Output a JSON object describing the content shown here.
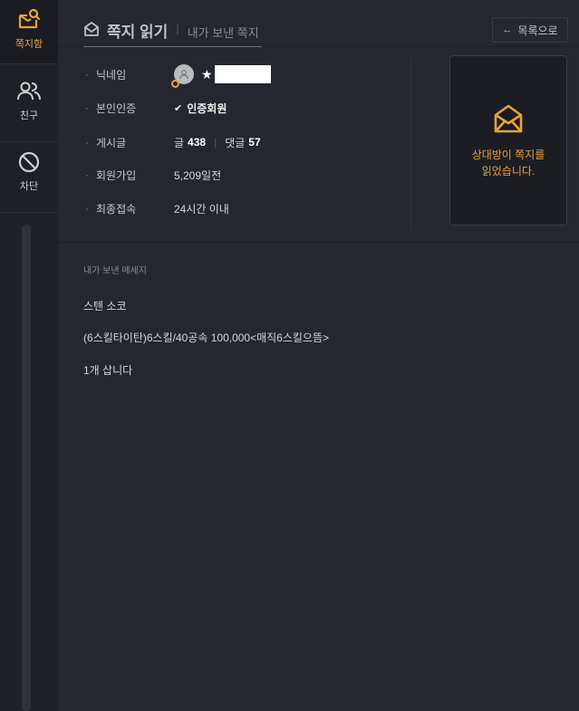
{
  "sidebar": {
    "items": [
      {
        "label": "쪽지함",
        "icon": "mail-search-icon",
        "active": true
      },
      {
        "label": "친구",
        "icon": "users-icon",
        "active": false
      },
      {
        "label": "차단",
        "icon": "block-icon",
        "active": false
      }
    ]
  },
  "header": {
    "title": "쪽지 읽기",
    "separator": "|",
    "subtitle": "내가 보낸 쪽지",
    "back_label": "목록으로",
    "back_arrow": "←"
  },
  "profile": {
    "bullet": "·",
    "nickname": {
      "label": "닉네임",
      "star": "★"
    },
    "verification": {
      "label": "본인인증",
      "check": "✔",
      "value": "인증회원"
    },
    "posts": {
      "label": "게시글",
      "post_label": "글",
      "post_count": "438",
      "sep": "|",
      "comment_label": "댓글",
      "comment_count": "57"
    },
    "joined": {
      "label": "회원가입",
      "value": "5,209일전"
    },
    "last_access": {
      "label": "최종접속",
      "value": "24시간 이내"
    }
  },
  "read_status": {
    "line1": "상대방이 쪽지를",
    "line2": "읽었습니다."
  },
  "message": {
    "label": "내가 보낸 메세지",
    "lines": [
      "스텐 소코",
      "(6스킬타이탄)6스킬/40공속 100,000<매직6스킬으뜸>",
      "1개 삽니다"
    ]
  },
  "colors": {
    "accent": "#e9a23b",
    "join_date": "#c15b5b",
    "background": "#24272e",
    "sidebar": "#1d2026"
  }
}
